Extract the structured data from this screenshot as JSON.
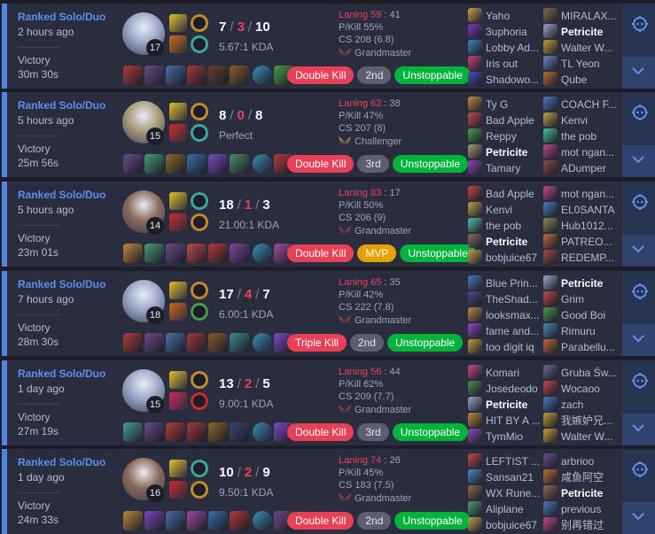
{
  "matches": [
    {
      "queue": "Ranked Solo/Duo",
      "time_ago": "2 hours ago",
      "result": "Victory",
      "duration": "30m 30s",
      "champion_icon": "champion-portrait",
      "champion_color": "#9aa6c8",
      "level": "17",
      "kills": "7",
      "deaths": "3",
      "assists": "10",
      "kda_ratio": "5.67:1 KDA",
      "spells": [
        "#e5c027",
        "#d06718"
      ],
      "runes": [
        "#c28a2e",
        "#3aa6a0"
      ],
      "items": [
        "#b23b3b",
        "#6c4a8c",
        "#4a6ea8",
        "#a03a3a",
        "#6a3f2a",
        "#8c5a2a",
        "#3c8fb8",
        "#4a9c4a"
      ],
      "badges": [
        {
          "label": "Double Kill",
          "type": "red"
        },
        {
          "label": "2nd",
          "type": "gray"
        },
        {
          "label": "Unstoppable",
          "type": "green"
        }
      ],
      "laning_label": "Laning 59",
      "laning_opp": ": 41",
      "pkill": "P/Kill 55%",
      "cs": "CS 208 (6.8)",
      "tier": "Grandmaster",
      "tier_color": "#b84a4a",
      "team1": [
        {
          "name": "Yaho",
          "c": "#c9a24a"
        },
        {
          "name": "3uphoria",
          "c": "#7a3ac0"
        },
        {
          "name": "Lobby Ad...",
          "c": "#3a86c0"
        },
        {
          "name": "Iris out",
          "c": "#c04a7a"
        },
        {
          "name": "Shadowo...",
          "c": "#4a4ac0"
        }
      ],
      "team2": [
        {
          "name": "MIRALAX...",
          "c": "#8a6a4a"
        },
        {
          "name": "Petricite",
          "c": "#9aa6c8",
          "me": true
        },
        {
          "name": "Walter W...",
          "c": "#c0a03a"
        },
        {
          "name": "TL Yeon",
          "c": "#6a8ac0"
        },
        {
          "name": "Qube",
          "c": "#c06a3a"
        }
      ]
    },
    {
      "queue": "Ranked Solo/Duo",
      "time_ago": "5 hours ago",
      "result": "Victory",
      "duration": "25m 56s",
      "champion_icon": "champion-portrait",
      "champion_color": "#a89a7a",
      "level": "15",
      "kills": "8",
      "deaths": "0",
      "assists": "8",
      "kda_ratio": "Perfect",
      "spells": [
        "#e5c027",
        "#d02a2a"
      ],
      "runes": [
        "#c28a2e",
        "#3aa6a0"
      ],
      "items": [
        "#6c4a8c",
        "#4a9c7a",
        "#8c6a2a",
        "#3a6ea8",
        "#7a4ac0",
        "#4a8c6a",
        "#3c8fb8",
        "#b23b3b"
      ],
      "badges": [
        {
          "label": "Double Kill",
          "type": "red"
        },
        {
          "label": "3rd",
          "type": "gray"
        },
        {
          "label": "Unstoppable",
          "type": "green"
        }
      ],
      "laning_label": "Laning 62",
      "laning_opp": ": 38",
      "pkill": "P/Kill 47%",
      "cs": "CS 207 (8)",
      "tier": "Challenger",
      "tier_color": "#d8a040",
      "team1": [
        {
          "name": "Ty G",
          "c": "#c08a3a"
        },
        {
          "name": "Bad Apple",
          "c": "#c04a4a"
        },
        {
          "name": "Reppy",
          "c": "#4a9c4a"
        },
        {
          "name": "Petricite",
          "c": "#a89a7a",
          "me": true
        },
        {
          "name": "Tamary",
          "c": "#8a4ac0"
        }
      ],
      "team2": [
        {
          "name": "COACH F...",
          "c": "#4a7ac0"
        },
        {
          "name": "Kenvi",
          "c": "#c0a04a"
        },
        {
          "name": "the pob",
          "c": "#4ac0a0"
        },
        {
          "name": "mot ngan...",
          "c": "#c04a8a"
        },
        {
          "name": "ADumper",
          "c": "#8a4a4a"
        }
      ]
    },
    {
      "queue": "Ranked Solo/Duo",
      "time_ago": "5 hours ago",
      "result": "Victory",
      "duration": "23m 01s",
      "champion_icon": "champion-portrait",
      "champion_color": "#8a6a5a",
      "level": "14",
      "kills": "18",
      "deaths": "1",
      "assists": "3",
      "kda_ratio": "21.00:1 KDA",
      "spells": [
        "#e5c027",
        "#d02a2a"
      ],
      "runes": [
        "#3aa6a0",
        "#c28a2e"
      ],
      "items": [
        "#c08a3a",
        "#4a9c7a",
        "#6c4a8c",
        "#c04a4a",
        "#b23b3b",
        "#7a4a9c",
        "#3c8fb8",
        "#a04a9c"
      ],
      "badges": [
        {
          "label": "Double Kill",
          "type": "red"
        },
        {
          "label": "MVP",
          "type": "mvp"
        },
        {
          "label": "Unstoppable",
          "type": "green"
        }
      ],
      "laning_label": "Laning 83",
      "laning_opp": ": 17",
      "pkill": "P/Kill 50%",
      "cs": "CS 206 (9)",
      "tier": "Grandmaster",
      "tier_color": "#b84a4a",
      "team1": [
        {
          "name": "Bad Apple",
          "c": "#c04a4a"
        },
        {
          "name": "Kenvi",
          "c": "#c0a04a"
        },
        {
          "name": "the pob",
          "c": "#4ac0a0"
        },
        {
          "name": "Petricite",
          "c": "#8a6a5a",
          "me": true
        },
        {
          "name": "bobjuice67",
          "c": "#c0a04a"
        }
      ],
      "team2": [
        {
          "name": "mot ngan...",
          "c": "#c04a8a"
        },
        {
          "name": "EL0SANTA",
          "c": "#4a7ac0"
        },
        {
          "name": "Hub1012...",
          "c": "#8a8a4a"
        },
        {
          "name": "PATREO...",
          "c": "#c06a3a"
        },
        {
          "name": "REDEMP...",
          "c": "#a04a4a"
        }
      ]
    },
    {
      "queue": "Ranked Solo/Duo",
      "time_ago": "7 hours ago",
      "result": "Victory",
      "duration": "28m 30s",
      "champion_icon": "champion-portrait",
      "champion_color": "#9aa6c8",
      "level": "18",
      "kills": "17",
      "deaths": "4",
      "assists": "7",
      "kda_ratio": "6.00:1 KDA",
      "spells": [
        "#e5c027",
        "#d06718"
      ],
      "runes": [
        "#c28a2e",
        "#4a9c4a"
      ],
      "items": [
        "#b23b3b",
        "#6c4a8c",
        "#4a6ea8",
        "#a03a3a",
        "#8c5a2a",
        "#3a8c8c",
        "#3c8fb8",
        "#7a4ac0"
      ],
      "badges": [
        {
          "label": "Triple Kill",
          "type": "red"
        },
        {
          "label": "2nd",
          "type": "gray"
        },
        {
          "label": "Unstoppable",
          "type": "green"
        }
      ],
      "laning_label": "Laning 65",
      "laning_opp": ": 35",
      "pkill": "P/Kill 42%",
      "cs": "CS 222 (7.8)",
      "tier": "Grandmaster",
      "tier_color": "#b84a4a",
      "team1": [
        {
          "name": "Blue Prin...",
          "c": "#4a7ac0"
        },
        {
          "name": "TheShad...",
          "c": "#4a4a8a"
        },
        {
          "name": "looksmax...",
          "c": "#c08a4a"
        },
        {
          "name": "fame and...",
          "c": "#8a4ac0"
        },
        {
          "name": "too digit iq",
          "c": "#c0a03a"
        }
      ],
      "team2": [
        {
          "name": "Petricite",
          "c": "#9aa6c8",
          "me": true
        },
        {
          "name": "Grim",
          "c": "#c04a4a"
        },
        {
          "name": "Good Boi",
          "c": "#4a9c4a"
        },
        {
          "name": "Rimuru",
          "c": "#4a8ac0"
        },
        {
          "name": "Parabellu...",
          "c": "#c06a3a"
        }
      ]
    },
    {
      "queue": "Ranked Solo/Duo",
      "time_ago": "1 day ago",
      "result": "Victory",
      "duration": "27m 19s",
      "champion_icon": "champion-portrait",
      "champion_color": "#9aa6c8",
      "level": "15",
      "kills": "13",
      "deaths": "2",
      "assists": "5",
      "kda_ratio": "9.00:1 KDA",
      "spells": [
        "#e5c027",
        "#d02a5a"
      ],
      "runes": [
        "#c28a2e",
        "#d02a2a"
      ],
      "items": [
        "#4a9c9c",
        "#6c4a8c",
        "#b23b3b",
        "#a03a3a",
        "#8c6a2a",
        "#3a4a6a",
        "#3c8fb8",
        "#7a4ac0"
      ],
      "badges": [
        {
          "label": "Double Kill",
          "type": "red"
        },
        {
          "label": "3rd",
          "type": "gray"
        },
        {
          "label": "Unstoppable",
          "type": "green"
        }
      ],
      "laning_label": "Laning 56",
      "laning_opp": ": 44",
      "pkill": "P/Kill 62%",
      "cs": "CS 209 (7.7)",
      "tier": "Grandmaster",
      "tier_color": "#b84a4a",
      "team1": [
        {
          "name": "Komari",
          "c": "#c04a8a"
        },
        {
          "name": "Josedeodo",
          "c": "#4a8a4a"
        },
        {
          "name": "Petricite",
          "c": "#9aa6c8",
          "me": true
        },
        {
          "name": "HIT BY A ...",
          "c": "#c08a3a"
        },
        {
          "name": "TymMio",
          "c": "#8a4ac0"
        }
      ],
      "team2": [
        {
          "name": "Gruba Św...",
          "c": "#6a6a8a"
        },
        {
          "name": "Wocaoo",
          "c": "#c04a4a"
        },
        {
          "name": "zach",
          "c": "#4a7ac0"
        },
        {
          "name": "我嫉妒兄...",
          "c": "#c0a03a"
        },
        {
          "name": "Walter W...",
          "c": "#c0a03a"
        }
      ]
    },
    {
      "queue": "Ranked Solo/Duo",
      "time_ago": "1 day ago",
      "result": "Victory",
      "duration": "24m 33s",
      "champion_icon": "champion-portrait",
      "champion_color": "#8a6a5a",
      "level": "16",
      "kills": "10",
      "deaths": "2",
      "assists": "9",
      "kda_ratio": "9.50:1 KDA",
      "spells": [
        "#e5c027",
        "#d02a2a"
      ],
      "runes": [
        "#3aa6a0",
        "#c28a2e"
      ],
      "items": [
        "#c08a3a",
        "#7a4ac0",
        "#4a6ea8",
        "#a04a9c",
        "#3a6ea8",
        "#b23b3b",
        "#3c8fb8",
        "#6c4a8c"
      ],
      "badges": [
        {
          "label": "Double Kill",
          "type": "red"
        },
        {
          "label": "2nd",
          "type": "gray"
        },
        {
          "label": "Unstoppable",
          "type": "green"
        }
      ],
      "laning_label": "Laning 74",
      "laning_opp": ": 26",
      "pkill": "P/Kill 45%",
      "cs": "CS 183 (7.5)",
      "tier": "Grandmaster",
      "tier_color": "#b84a4a",
      "team1": [
        {
          "name": "LEFTIST ...",
          "c": "#c04a4a"
        },
        {
          "name": "Sansan21",
          "c": "#4a8ac0"
        },
        {
          "name": "WX Rune...",
          "c": "#8a6a4a"
        },
        {
          "name": "Aliplane",
          "c": "#4a9c7a"
        },
        {
          "name": "bobjuice67",
          "c": "#c0a04a"
        }
      ],
      "team2": [
        {
          "name": "arbrioo",
          "c": "#6a4a8a"
        },
        {
          "name": "咸鱼阿空",
          "c": "#c06a3a"
        },
        {
          "name": "Petricite",
          "c": "#8a6a5a",
          "me": true
        },
        {
          "name": "previous",
          "c": "#4a7ac0"
        },
        {
          "name": "别再错过",
          "c": "#c04a8a"
        }
      ]
    }
  ]
}
